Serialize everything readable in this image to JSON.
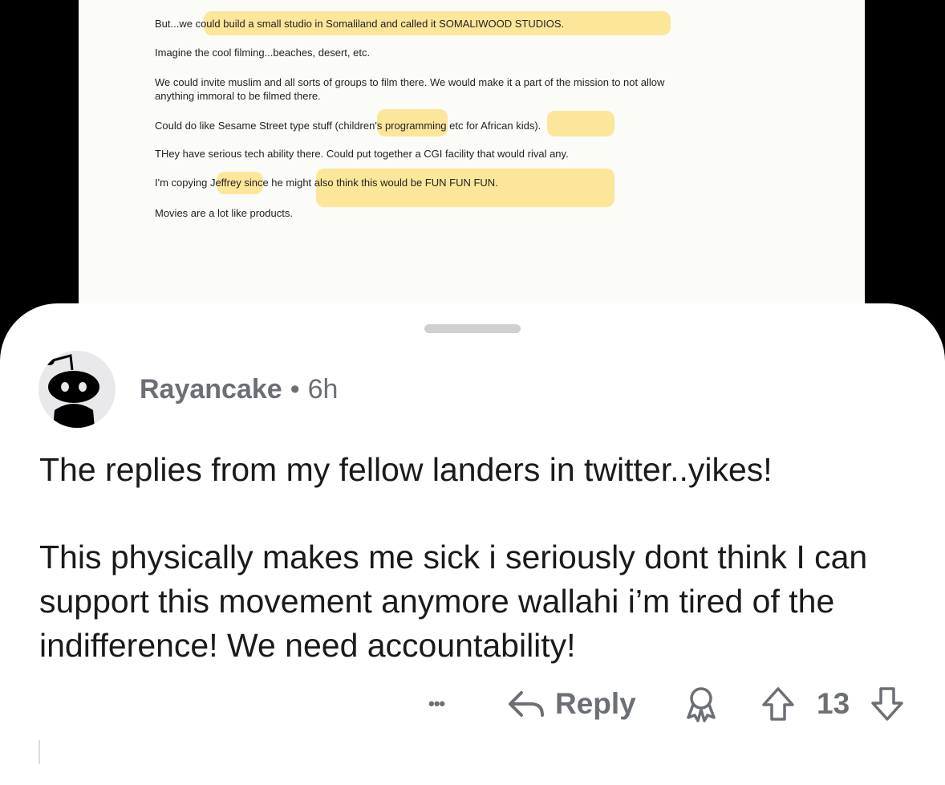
{
  "document": {
    "lines": [
      "But...we could build a small studio in Somaliland and called it SOMALIWOOD STUDIOS.",
      "Imagine the cool filming...beaches, desert, etc.",
      "We could invite muslim and all sorts of groups to film there. We would make it a part of the mission to not allow",
      "anything immoral to be filmed there.",
      "Could do like Sesame Street type stuff (children's programming etc for African kids).",
      "THey have serious tech ability there. Could put together a CGI facility that would rival any.",
      "I'm copying Jeffrey since he might also think this would be FUN FUN FUN.",
      "Movies are a lot like products."
    ],
    "highlight_color": "#fbe28a"
  },
  "comment": {
    "username": "Rayancake",
    "separator": "•",
    "time": "6h",
    "paragraphs": [
      "The replies from my fellow landers in twitter..yikes!",
      "This physically makes me sick i seriously dont think I can support this movement anymore wallahi i’m tired of the indifference! We need accountability!"
    ],
    "actions": {
      "more_label": "•••",
      "reply_label": "Reply",
      "vote_count": "13"
    },
    "avatar_icon": "snoo-avatar-icon"
  },
  "colors": {
    "meta_gray": "#6c6f75",
    "text": "#1a1a1b",
    "sheet_bg": "#ffffff"
  }
}
